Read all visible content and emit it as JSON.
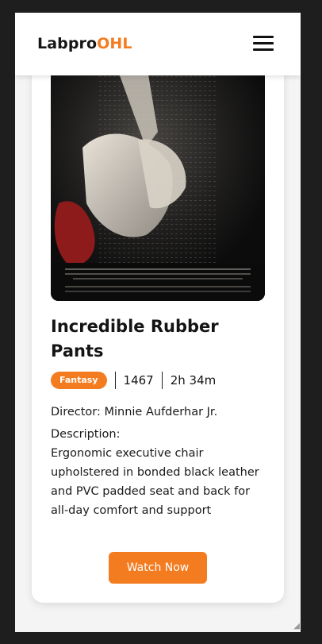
{
  "header": {
    "logo_main": "Labpro",
    "logo_accent": "OHL",
    "menu_icon": "hamburger-menu-icon"
  },
  "movie": {
    "title": "Incredible Rubber Pants",
    "genre": "Fantasy",
    "views": "1467",
    "duration": "2h 34m",
    "director": "Director: Minnie Aufderhar Jr.",
    "description_label": "Description:",
    "description": "Ergonomic executive chair upholstered in bonded black leather and PVC padded seat and back for all-day comfort and support",
    "watch_label": "Watch Now"
  },
  "colors": {
    "accent": "#f47c20",
    "card": "#ffffff",
    "background": "#f4f4f4"
  }
}
